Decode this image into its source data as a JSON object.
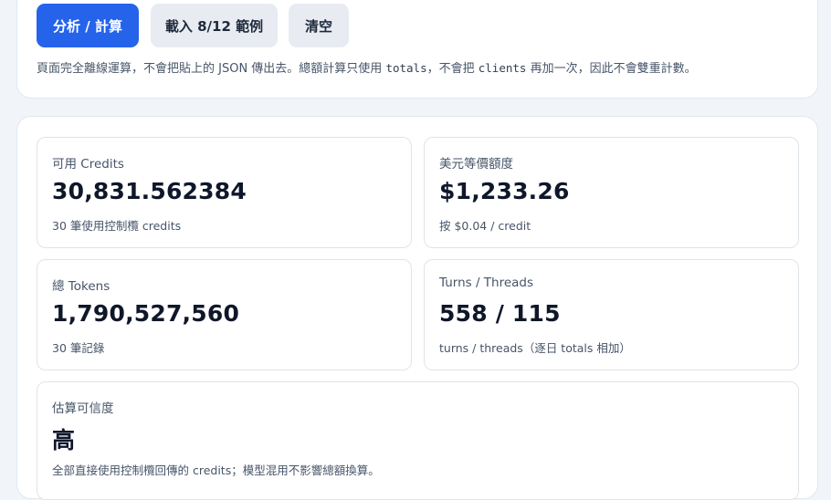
{
  "toolbar": {
    "analyze_label": "分析 / 計算",
    "load_example_label": "載入 8/12 範例",
    "clear_label": "清空"
  },
  "note": {
    "part1": "頁面完全離線運算，不會把貼上的 JSON 傳出去。總額計算只使用 ",
    "code1": "totals",
    "part2": "，不會把 ",
    "code2": "clients",
    "part3": " 再加一次，因此不會雙重計數。"
  },
  "cards": {
    "credits": {
      "label": "可用 Credits",
      "value": "30,831.562384",
      "sub": "30 筆使用控制欖 credits"
    },
    "usd": {
      "label": "美元等價額度",
      "value": "$1,233.26",
      "sub": "按 $0.04 / credit"
    },
    "tokens": {
      "label": "總 Tokens",
      "value": "1,790,527,560",
      "sub": "30 筆記錄"
    },
    "turns": {
      "label": "Turns / Threads",
      "value": "558 / 115",
      "sub": "turns / threads（逐日 totals 相加）"
    },
    "confidence": {
      "label": "估算可信度",
      "value": "高",
      "sub": "全部直接使用控制欖回傳的 credits；模型混用不影響總額換算。"
    }
  }
}
